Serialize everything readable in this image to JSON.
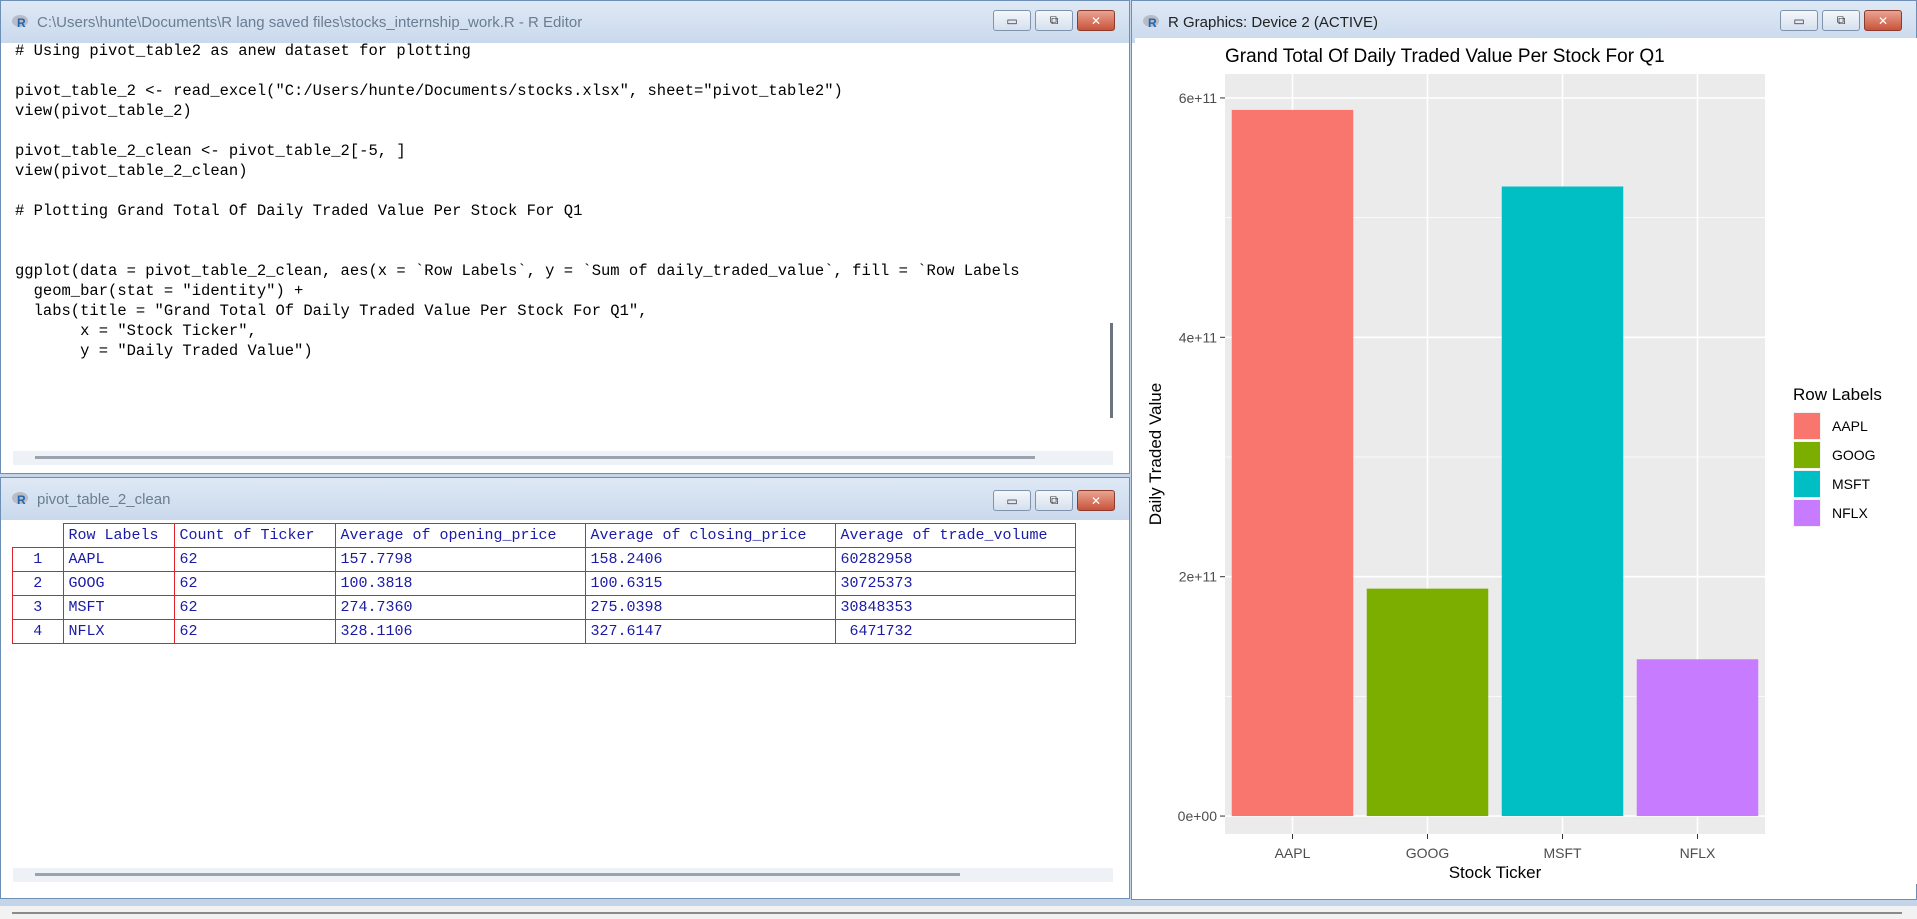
{
  "editor": {
    "title": "C:\\Users\\hunte\\Documents\\R lang saved files\\stocks_internship_work.R - R Editor",
    "code": "# Using pivot_table2 as anew dataset for plotting\n\npivot_table_2 <- read_excel(\"C:/Users/hunte/Documents/stocks.xlsx\", sheet=\"pivot_table2\")\nview(pivot_table_2)\n\npivot_table_2_clean <- pivot_table_2[-5, ]\nview(pivot_table_2_clean)\n\n# Plotting Grand Total Of Daily Traded Value Per Stock For Q1\n\n\nggplot(data = pivot_table_2_clean, aes(x = `Row Labels`, y = `Sum of daily_traded_value`, fill = `Row Labels\n  geom_bar(stat = \"identity\") +\n  labs(title = \"Grand Total Of Daily Traded Value Per Stock For Q1\",\n       x = \"Stock Ticker\",\n       y = \"Daily Traded Value\")"
  },
  "viewer": {
    "title": "pivot_table_2_clean",
    "columns": [
      "Row Labels",
      "Count of Ticker",
      "Average of opening_price",
      "Average of closing_price",
      "Average of trade_volume"
    ],
    "rows": [
      {
        "n": "1",
        "cells": [
          "AAPL",
          "62",
          "157.7798",
          "158.2406",
          "60282958"
        ]
      },
      {
        "n": "2",
        "cells": [
          "GOOG",
          "62",
          "100.3818",
          "100.6315",
          "30725373"
        ]
      },
      {
        "n": "3",
        "cells": [
          "MSFT",
          "62",
          "274.7360",
          "275.0398",
          "30848353"
        ]
      },
      {
        "n": "4",
        "cells": [
          "NFLX",
          "62",
          "328.1106",
          "327.6147",
          " 6471732"
        ]
      }
    ]
  },
  "graphics": {
    "title": "R Graphics: Device 2 (ACTIVE)"
  },
  "window_buttons": {
    "minimize": "▭",
    "maximize": "⧉",
    "close": "✕"
  },
  "icons": {
    "r_logo": "r-logo-icon",
    "minimize": "minimize-icon",
    "maximize": "maximize-icon",
    "close": "close-icon"
  },
  "chart_data": {
    "type": "bar",
    "title": "Grand Total Of Daily Traded Value Per Stock For Q1",
    "xlabel": "Stock Ticker",
    "ylabel": "Daily Traded Value",
    "categories": [
      "AAPL",
      "GOOG",
      "MSFT",
      "NFLX"
    ],
    "values": [
      590000000000,
      190000000000,
      526000000000,
      131000000000
    ],
    "colors": [
      "#F8766D",
      "#7CAE00",
      "#00BFC4",
      "#C77CFF"
    ],
    "ylim": [
      -15000000000,
      620000000000
    ],
    "yticks": [
      0,
      200000000000,
      400000000000,
      600000000000
    ],
    "ytick_labels": [
      "0e+00",
      "2e+11",
      "4e+11",
      "6e+11"
    ],
    "legend_title": "Row Labels",
    "legend_position": "right",
    "panel_background": "#EBEBEB",
    "grid": true
  }
}
